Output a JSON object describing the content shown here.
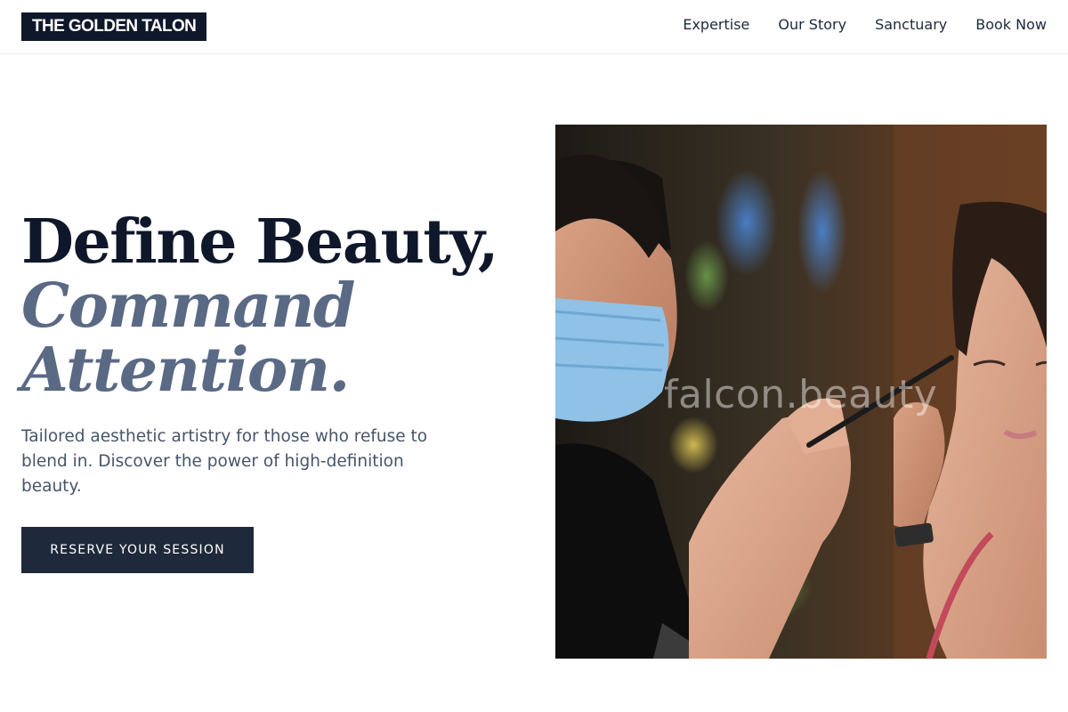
{
  "brand": {
    "name": "THE GOLDEN TALON"
  },
  "nav": {
    "items": [
      {
        "label": "Expertise"
      },
      {
        "label": "Our Story"
      },
      {
        "label": "Sanctuary"
      },
      {
        "label": "Book Now"
      }
    ]
  },
  "hero": {
    "headline_line1": "Define Beauty,",
    "headline_line2": "Command",
    "headline_line3": "Attention.",
    "subtext": "Tailored aesthetic artistry for those who refuse to blend in. Discover the power of high-definition beauty.",
    "cta_label": "RESERVE YOUR SESSION",
    "image_watermark": "falcon.beauty"
  },
  "colors": {
    "brand_dark": "#0f172a",
    "accent_slate": "#5a6984",
    "button_bg": "#1e293b",
    "body_text": "#475569"
  }
}
